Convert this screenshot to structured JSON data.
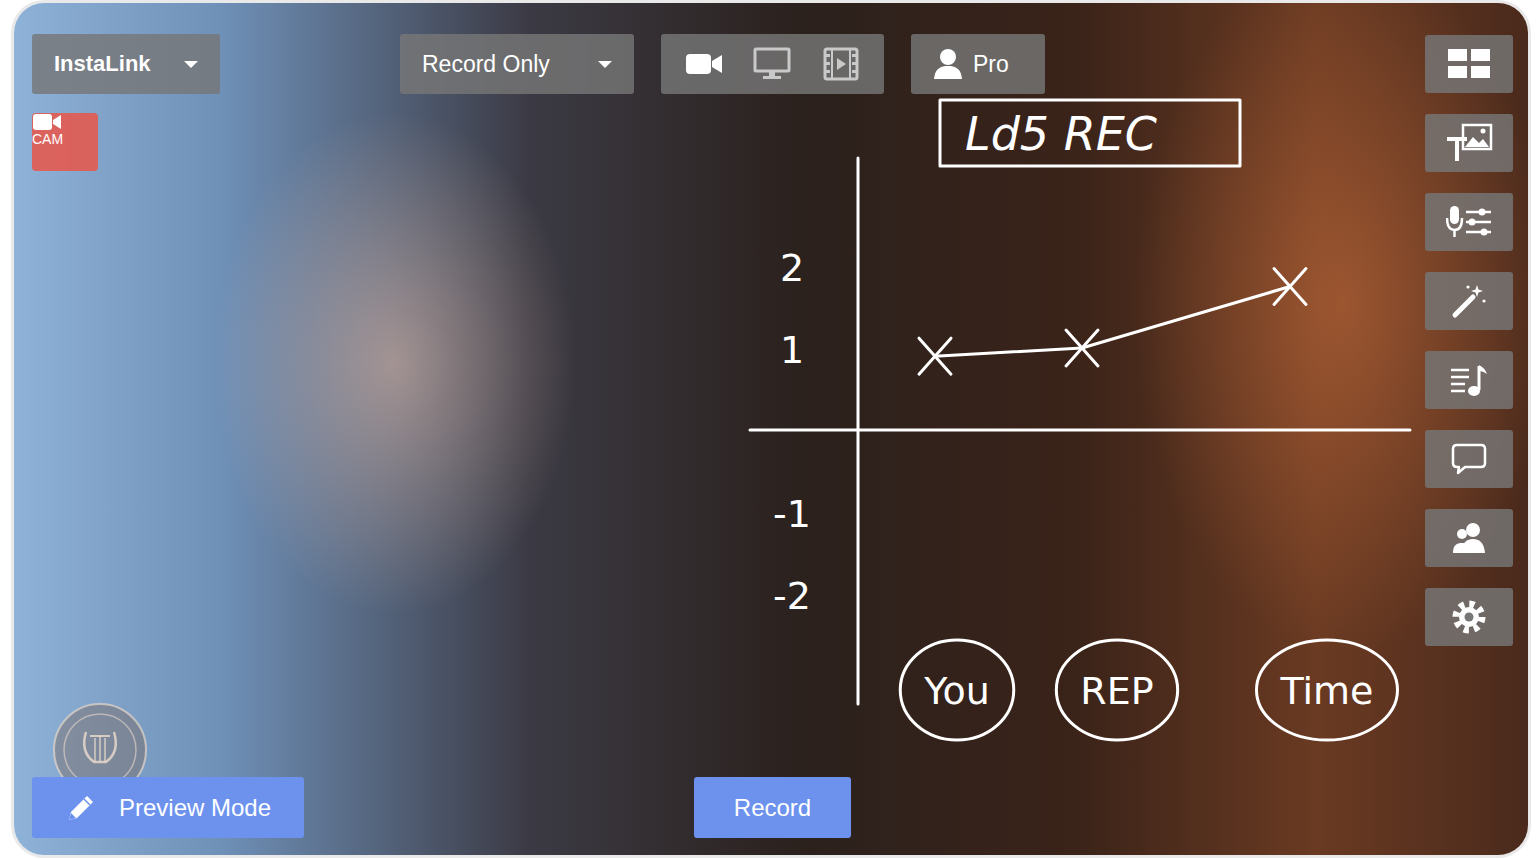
{
  "source_dropdown": {
    "label": "InstaLink"
  },
  "mode_dropdown": {
    "label": "Record Only"
  },
  "view_modes": [
    {
      "kind": "camera",
      "selected": true
    },
    {
      "kind": "screen",
      "selected": false
    },
    {
      "kind": "media",
      "selected": false
    }
  ],
  "account_button": {
    "label": "Pro"
  },
  "camera_badge": {
    "label": "CAM",
    "on": true
  },
  "annotation": {
    "title": "Ld5 REC",
    "chart": {
      "y_ticks": [
        "2",
        "1",
        "-1",
        "-2"
      ],
      "x_labels": [
        "You",
        "REP",
        "Time"
      ],
      "series": [
        {
          "values": [
            0.9,
            1.0,
            1.75
          ]
        }
      ]
    }
  },
  "buttons": {
    "preview": "Preview Mode",
    "record": "Record"
  }
}
